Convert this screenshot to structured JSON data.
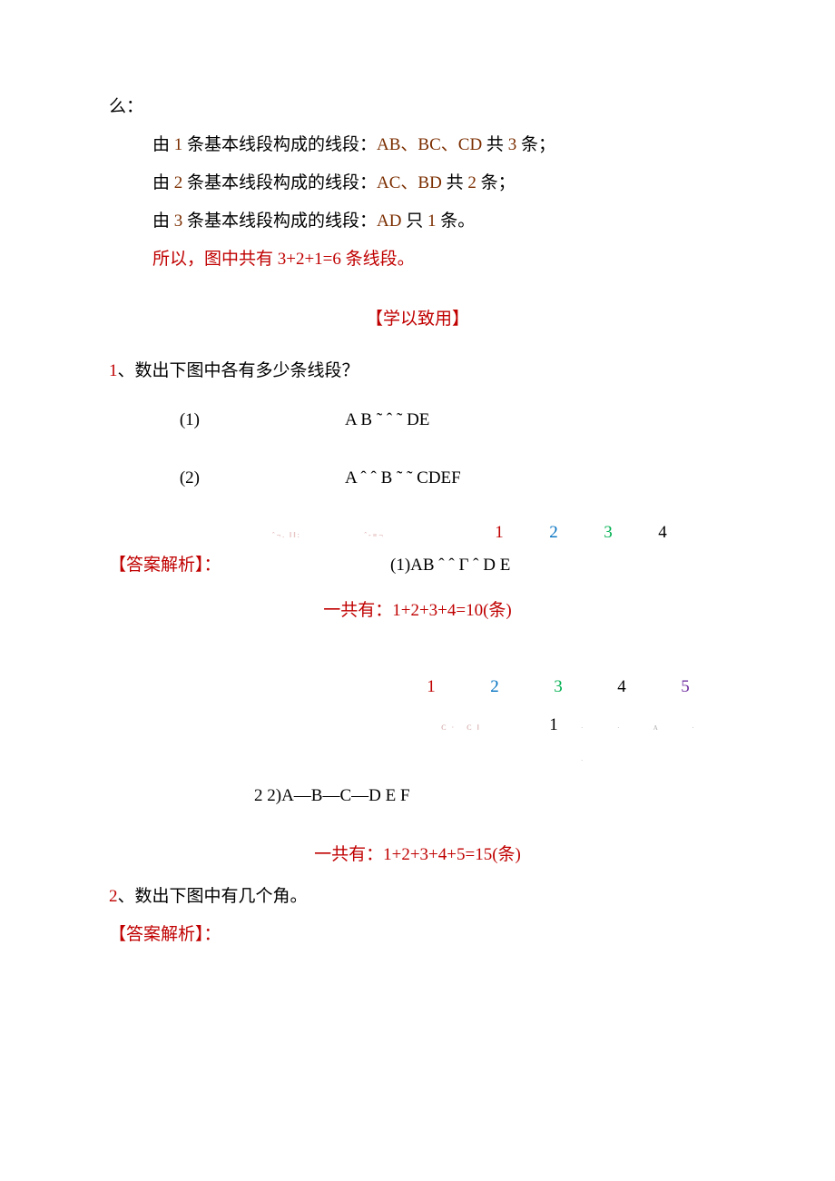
{
  "intro": {
    "frag": "么：",
    "lines": [
      {
        "black_a": "由 ",
        "brown_a": "1",
        "black_b": " 条基本线段构成的线段：",
        "brown_b": "AB、BC、CD",
        "black_c": " 共 ",
        "brown_c": "3",
        "black_d": " 条；"
      },
      {
        "black_a": "由 ",
        "brown_a": "2",
        "black_b": " 条基本线段构成的线段：",
        "brown_b": "AC、BD",
        "black_c": " 共 ",
        "brown_c": "2",
        "black_d": " 条；"
      },
      {
        "black_a": "由 ",
        "brown_a": "3",
        "black_b": " 条基本线段构成的线段：",
        "brown_b": "AD",
        "black_c": " 只 ",
        "brown_c": "1",
        "black_d": " 条。"
      }
    ],
    "conclusion": "所以，图中共有 3+2+1=6 条线段。"
  },
  "section_title": "【学以致用】",
  "q1": {
    "num": "1",
    "sep": "、",
    "text": "数出下图中各有多少条线段？",
    "sub1_label": "(1)",
    "sub1_diagram": "A     B ˜ ˆ ˜ DE",
    "sub2_label": "(2)",
    "sub2_diagram": "A ˆ ˆ B ˜ ˜ CDEF",
    "answer_label": "【答案解析】：",
    "ans1_nums": {
      "n1": "1",
      "n2": "2",
      "n3": "3",
      "n4": "4"
    },
    "ans1_diagram": "(1)AB ˆ ˆ Γ ˆ D      E",
    "ans1_total": "一共有：1+2+3+4=10(条)",
    "ans2_nums": {
      "n1": "1",
      "n2": "2",
      "n3": "3",
      "n4": "4",
      "n5": "5"
    },
    "ans2_mid_one": "1",
    "ans2_diagram_left": "2     2)A—B—C—D        E       F",
    "ans2_total": "一共有：1+2+3+4+5=15(条)"
  },
  "q2": {
    "num": "2",
    "sep": "、",
    "text": "数出下图中有几个角。",
    "answer_label": "【答案解析】："
  },
  "deco": {
    "tiny1": "ˆ¬. ‖‖:",
    "tiny2": "ˆ-≡¬",
    "ticks": "· · A · ·"
  }
}
